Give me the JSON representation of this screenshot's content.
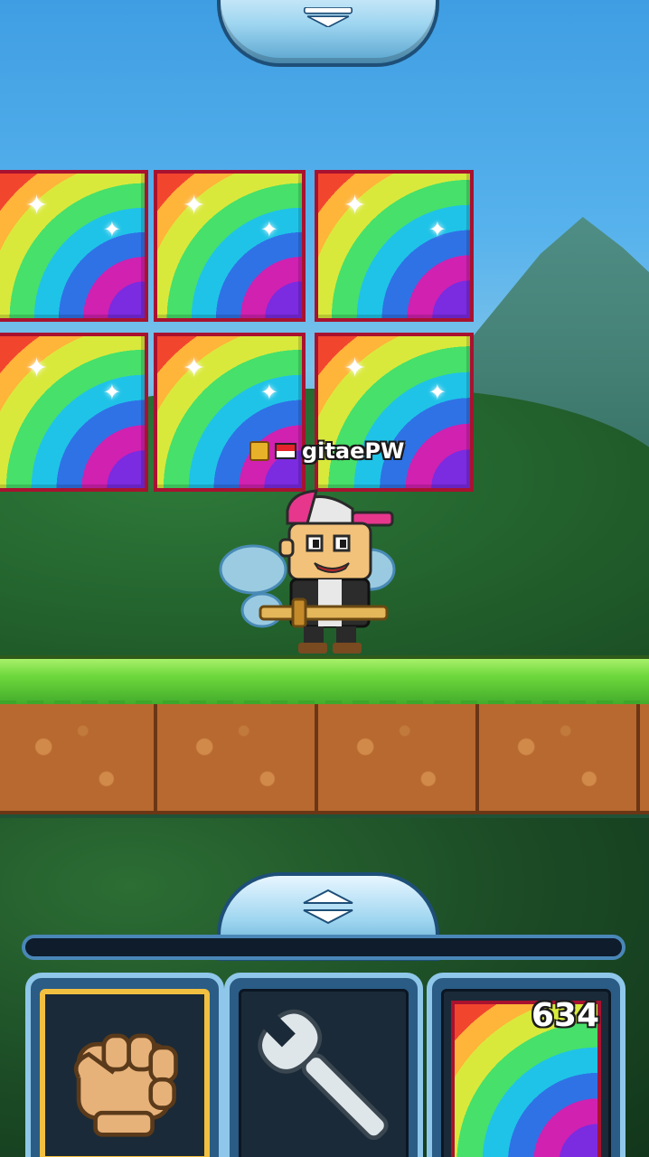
{
  "player": {
    "name": "gitaePW",
    "flag_icon": "indonesia-flag-icon",
    "lock_icon": "gold-lock-icon",
    "outfit": [
      "pink-cap",
      "fairy-wings",
      "golden-sword",
      "black-jacket"
    ]
  },
  "world": {
    "blocks": [
      "rainbow-block",
      "rainbow-block",
      "rainbow-block",
      "rainbow-block",
      "rainbow-block",
      "rainbow-block"
    ],
    "ground_tiles": [
      "dirt-block",
      "dirt-block",
      "dirt-block",
      "dirt-block",
      "dirt-block"
    ],
    "surface": "grass"
  },
  "controls": {
    "top_handle_icon": "double-chevron-down-icon",
    "bottom_handle_icon": "double-chevron-up-icon"
  },
  "inventory": {
    "slots": [
      {
        "item": "fist",
        "icon": "fist-icon",
        "selected": true
      },
      {
        "item": "wrench",
        "icon": "wrench-icon",
        "selected": false
      },
      {
        "item": "rainbow-block",
        "icon": "rainbow-block-icon",
        "selected": false,
        "count": "634"
      }
    ]
  },
  "colors": {
    "slot_highlight": "#f1c040",
    "slot_frame": "#8fc7ea",
    "block_border": "#a8122f"
  }
}
